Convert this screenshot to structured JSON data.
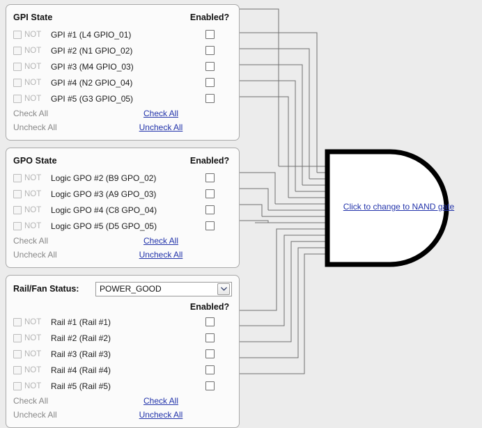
{
  "page": {
    "background_color": "#ececec",
    "link_color": "#2233aa",
    "disabled_color": "#b4b4b4"
  },
  "panels": [
    {
      "id": "gpi-state",
      "title": "GPI State",
      "enabled_header": "Enabled?",
      "not_label": "NOT",
      "rows": [
        {
          "label": "GPI #1 (L4 GPIO_01)",
          "not_checked": false,
          "enabled_checked": false
        },
        {
          "label": "GPI #2 (N1 GPIO_02)",
          "not_checked": false,
          "enabled_checked": false
        },
        {
          "label": "GPI #3 (M4 GPIO_03)",
          "not_checked": false,
          "enabled_checked": false
        },
        {
          "label": "GPI #4 (N2 GPIO_04)",
          "not_checked": false,
          "enabled_checked": false
        },
        {
          "label": "GPI #5 (G3 GPIO_05)",
          "not_checked": false,
          "enabled_checked": false
        }
      ],
      "footer": {
        "left_check_all": "Check All",
        "left_uncheck_all": "Uncheck All",
        "right_check_all": "Check All",
        "right_uncheck_all": "Uncheck All"
      }
    },
    {
      "id": "gpo-state",
      "title": "GPO State",
      "enabled_header": "Enabled?",
      "not_label": "NOT",
      "rows": [
        {
          "label": "Logic GPO #2 (B9 GPO_02)",
          "not_checked": false,
          "enabled_checked": false
        },
        {
          "label": "Logic GPO #3 (A9 GPO_03)",
          "not_checked": false,
          "enabled_checked": false
        },
        {
          "label": "Logic GPO #4 (C8 GPO_04)",
          "not_checked": false,
          "enabled_checked": false
        },
        {
          "label": "Logic GPO #5 (D5 GPO_05)",
          "not_checked": false,
          "enabled_checked": false
        }
      ],
      "footer": {
        "left_check_all": "Check All",
        "left_uncheck_all": "Uncheck All",
        "right_check_all": "Check All",
        "right_uncheck_all": "Uncheck All"
      }
    },
    {
      "id": "rail-fan-status",
      "title": "Rail/Fan Status:",
      "enabled_header": "Enabled?",
      "not_label": "NOT",
      "select": {
        "value": "POWER_GOOD",
        "icon": "chevron-down-icon"
      },
      "rows": [
        {
          "label": "Rail #1 (Rail #1)",
          "not_checked": false,
          "enabled_checked": false
        },
        {
          "label": "Rail #2 (Rail #2)",
          "not_checked": false,
          "enabled_checked": false
        },
        {
          "label": "Rail #3 (Rail #3)",
          "not_checked": false,
          "enabled_checked": false
        },
        {
          "label": "Rail #4 (Rail #4)",
          "not_checked": false,
          "enabled_checked": false
        },
        {
          "label": "Rail #5 (Rail #5)",
          "not_checked": false,
          "enabled_checked": false
        }
      ],
      "footer": {
        "left_check_all": "Check All",
        "left_uncheck_all": "Uncheck All",
        "right_check_all": "Check All",
        "right_uncheck_all": "Uncheck All"
      }
    }
  ],
  "gate": {
    "type": "AND",
    "link_label": "Click to change to NAND gate",
    "input_count": 14
  }
}
